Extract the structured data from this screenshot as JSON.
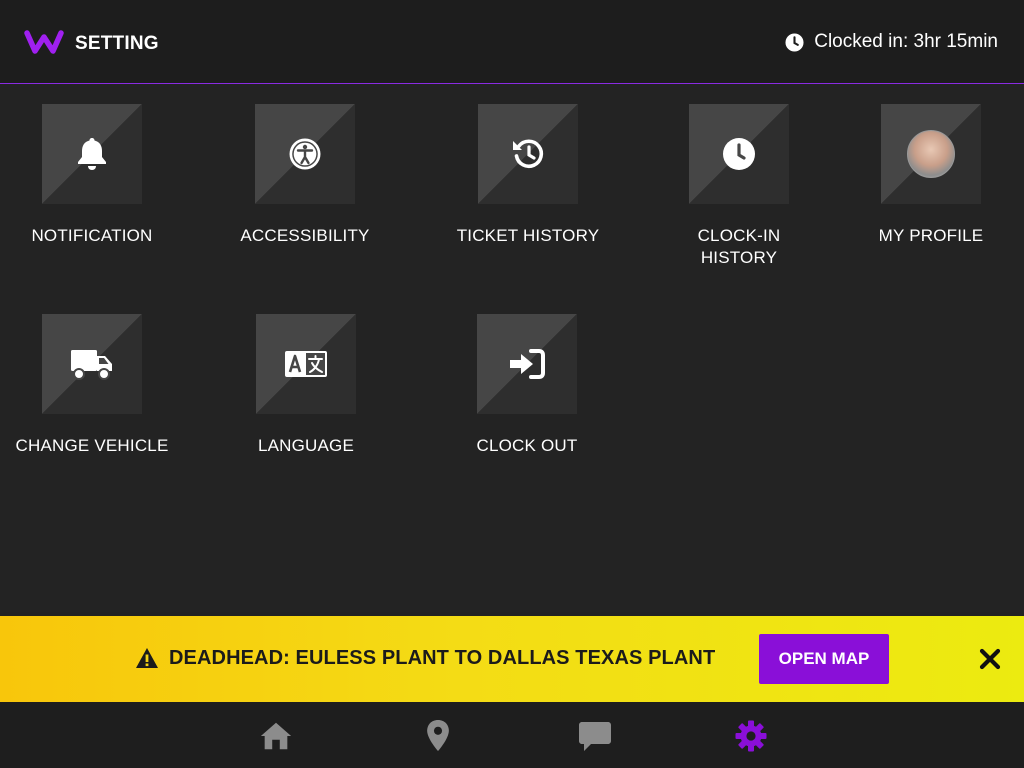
{
  "header": {
    "title": "SETTING",
    "clock_status": "Clocked in: 3hr 15min"
  },
  "tiles": [
    {
      "label": "NOTIFICATION",
      "icon": "bell-icon"
    },
    {
      "label": "ACCESSIBILITY",
      "icon": "accessibility-icon"
    },
    {
      "label": "TICKET HISTORY",
      "icon": "history-icon"
    },
    {
      "label_line1": "CLOCK-IN",
      "label_line2": "HISTORY",
      "icon": "clock-icon"
    },
    {
      "label": "MY PROFILE",
      "icon": "avatar"
    },
    {
      "label": "CHANGE VEHICLE",
      "icon": "truck-icon"
    },
    {
      "label": "LANGUAGE",
      "icon": "translate-icon"
    },
    {
      "label": "CLOCK OUT",
      "icon": "sign-in-icon"
    }
  ],
  "banner": {
    "text": "DEADHEAD: EULESS PLANT TO DALLAS TEXAS PLANT",
    "button_label": "OPEN MAP",
    "icon": "warning-icon"
  },
  "bottom_nav": [
    {
      "icon": "home-icon"
    },
    {
      "icon": "map-pin-icon"
    },
    {
      "icon": "chat-icon"
    },
    {
      "icon": "gear-icon",
      "active": true
    }
  ],
  "colors": {
    "accent": "#8a0fd8",
    "background": "#232323",
    "tile": "#464646",
    "banner": "#f4dc15",
    "nav_inactive": "#8c8c8c"
  }
}
